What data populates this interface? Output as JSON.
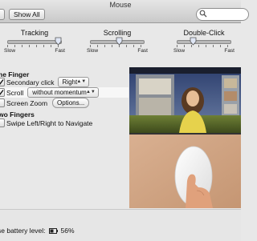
{
  "window": {
    "title": "Mouse"
  },
  "toolbar": {
    "show_all_label": "Show All",
    "search_value": ""
  },
  "sliders": [
    {
      "title": "Tracking",
      "min_label": "Slow",
      "max_label": "Fast",
      "value": 0.95
    },
    {
      "title": "Scrolling",
      "min_label": "Slow",
      "max_label": "Fast",
      "value": 0.55
    },
    {
      "title": "Double-Click",
      "min_label": "Slow",
      "max_label": "Fast",
      "value": 0.3
    }
  ],
  "one_finger": {
    "heading": "ne Finger",
    "secondary_click": {
      "label": "Secondary click",
      "checked": true,
      "popup_value": "Right"
    },
    "scroll": {
      "label": "Scroll",
      "checked": true,
      "popup_value": "without momentum"
    },
    "screen_zoom": {
      "label": "Screen Zoom",
      "checked": false,
      "button_label": "Options..."
    }
  },
  "two_fingers": {
    "heading": "wo Fingers",
    "swipe": {
      "label": "Swipe Left/Right to Navigate",
      "checked": false
    }
  },
  "footer": {
    "battery_label": "se battery level:",
    "battery_value": "56%"
  },
  "icons": {
    "search": "search-icon",
    "checkmark": "checkmark-icon",
    "battery": "battery-icon",
    "updown": "popup-arrows-icon"
  }
}
